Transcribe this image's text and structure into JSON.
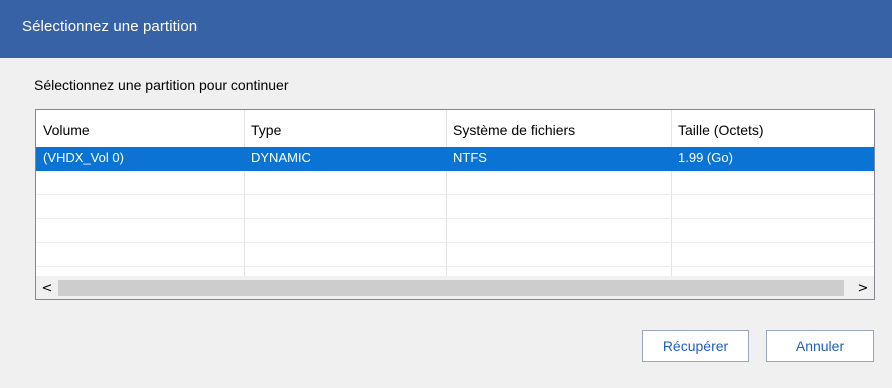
{
  "window": {
    "title": "Sélectionnez une partition"
  },
  "instruction": "Sélectionnez une partition pour continuer",
  "table": {
    "columns": [
      "Volume",
      "Type",
      "Système de fichiers",
      "Taille (Octets)"
    ],
    "rows": [
      [
        "(VHDX_Vol 0)",
        "DYNAMIC",
        "NTFS",
        "1.99 (Go)"
      ],
      [
        "",
        "",
        "",
        ""
      ],
      [
        "",
        "",
        "",
        ""
      ],
      [
        "",
        "",
        "",
        ""
      ],
      [
        "",
        "",
        "",
        ""
      ]
    ],
    "selected_row": 0
  },
  "scrollbar": {
    "left_arrow": "<",
    "right_arrow": ">",
    "thumb_fraction": 0.99
  },
  "buttons": {
    "recover": "Récupérer",
    "cancel": "Annuler"
  },
  "colors": {
    "titlebar": "#3763a6",
    "selection": "#0a73d4",
    "button_text": "#1f5fc1"
  }
}
